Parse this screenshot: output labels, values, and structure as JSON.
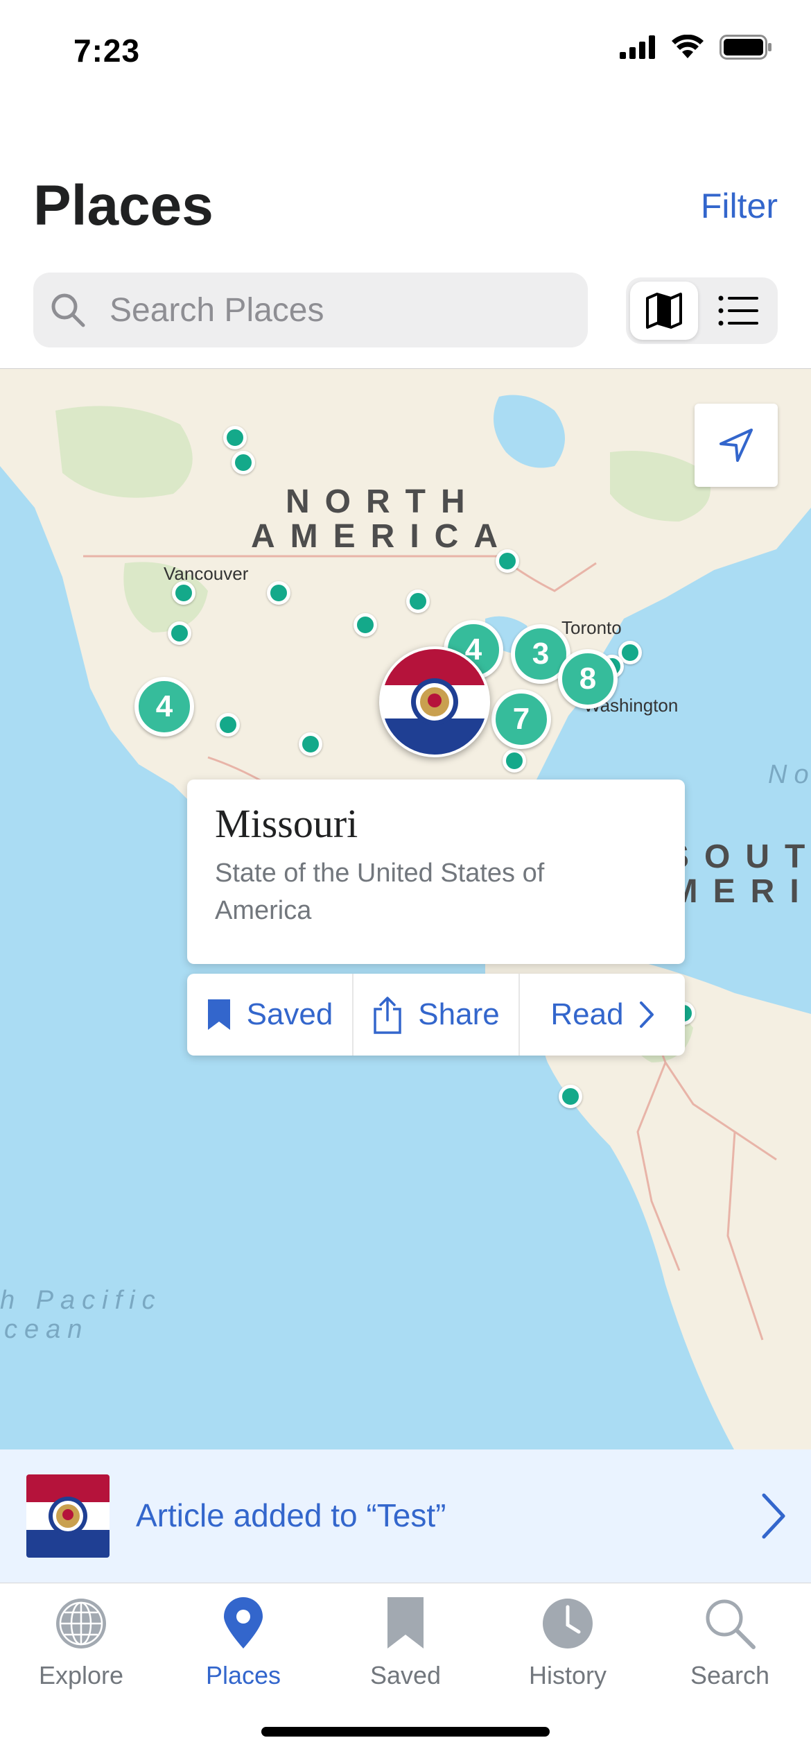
{
  "status_bar": {
    "time": "7:23"
  },
  "header": {
    "title": "Places",
    "filter_label": "Filter"
  },
  "search": {
    "placeholder": "Search Places",
    "value": ""
  },
  "view_toggle": {
    "selected": "map"
  },
  "map": {
    "labels": {
      "north_america_1": "NORTH",
      "north_america_2": "AMERICA",
      "south_america_1": "SOUT",
      "south_america_2": "AMERI",
      "pacific_1": "h Pacific",
      "pacific_2": "cean",
      "atlantic": "No",
      "vancouver": "Vancouver",
      "toronto": "Toronto",
      "washington": "Washington"
    },
    "clusters": {
      "west": "4",
      "great_lakes": "4",
      "ontario": "3",
      "east_coast": "8",
      "southeast": "7"
    }
  },
  "callout": {
    "title": "Missouri",
    "description": "State of the United States of America",
    "actions": {
      "saved": "Saved",
      "share": "Share",
      "read": "Read"
    }
  },
  "toast": {
    "text": "Article added to “Test”"
  },
  "tabs": [
    {
      "label": "Explore",
      "icon": "globe-icon"
    },
    {
      "label": "Places",
      "icon": "map-pin-icon"
    },
    {
      "label": "Saved",
      "icon": "bookmark-icon"
    },
    {
      "label": "History",
      "icon": "clock-icon"
    },
    {
      "label": "Search",
      "icon": "search-icon"
    }
  ],
  "colors": {
    "accent": "#3366cc",
    "pin": "#14a98a",
    "cluster": "#36bc9b",
    "map_water": "#aadcf3",
    "map_land": "#f4efe2",
    "toast_bg": "#eaf3ff"
  }
}
